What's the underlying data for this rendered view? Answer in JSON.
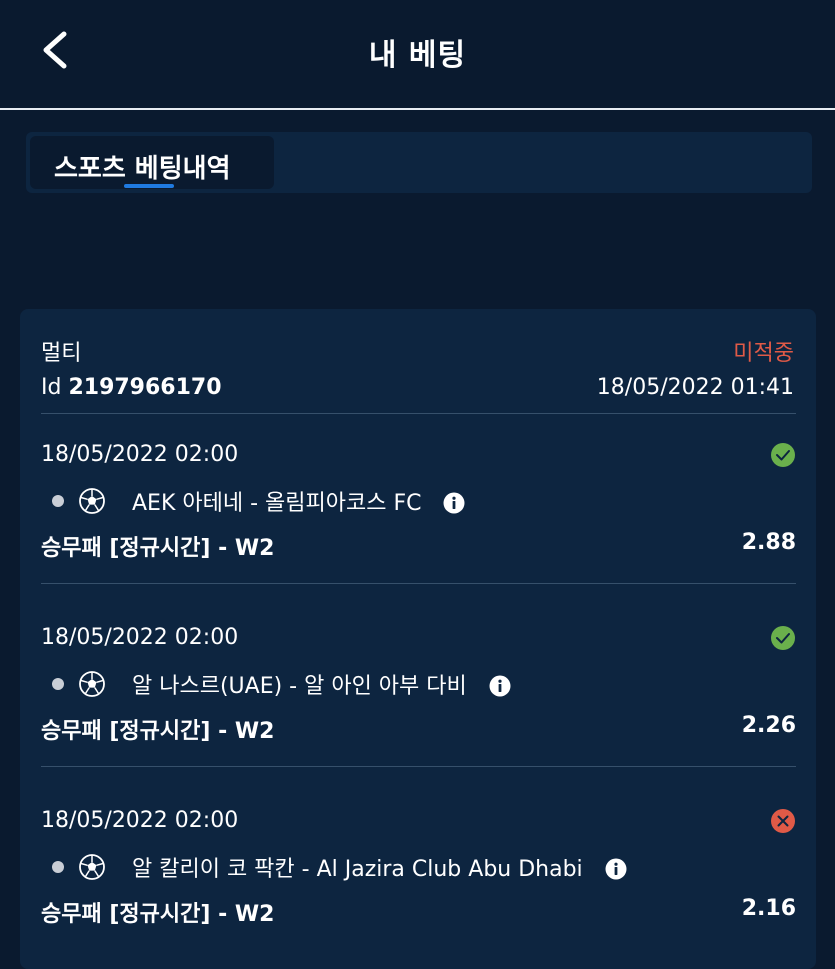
{
  "header": {
    "back_icon": "chevron-left-icon",
    "title": "내 베팅"
  },
  "tabs": [
    {
      "label": "스포츠 베팅내역",
      "active": true
    }
  ],
  "bet": {
    "type": "멀티",
    "status": "미적중",
    "status_color": "#e05a47",
    "id_label": "Id",
    "id_value": "2197966170",
    "datetime": "18/05/2022 01:41",
    "events": [
      {
        "date": "18/05/2022 02:00",
        "result": "won",
        "result_icon": "check-circle-icon",
        "sport_icon": "soccer-ball-icon",
        "name": "AEK 아테네 - 올림피아코스 FC",
        "market": "승무패 [정규시간] - W2",
        "odds": "2.88"
      },
      {
        "date": "18/05/2022 02:00",
        "result": "won",
        "result_icon": "check-circle-icon",
        "sport_icon": "soccer-ball-icon",
        "name": "알 나스르(UAE) - 알 아인 아부 다비",
        "market": "승무패 [정규시간] - W2",
        "odds": "2.26"
      },
      {
        "date": "18/05/2022 02:00",
        "result": "lost",
        "result_icon": "x-circle-icon",
        "sport_icon": "soccer-ball-icon",
        "name": "알 칼리이 코 팍칸 - Al Jazira Club Abu Dhabi",
        "market": "승무패 [정규시간] - W2",
        "odds": "2.16"
      }
    ]
  },
  "colors": {
    "background": "#0a1a2f",
    "card": "#0d2540",
    "accent": "#1f7ae0",
    "won": "#6ab04c",
    "lost": "#e05a47"
  }
}
